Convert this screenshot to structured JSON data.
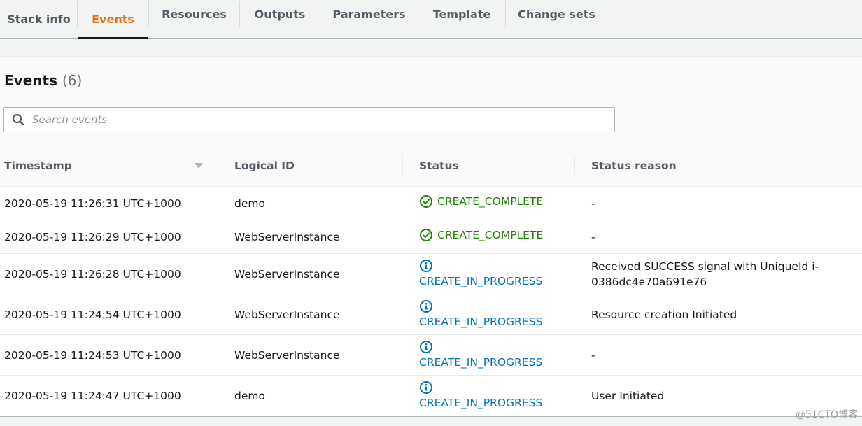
{
  "tabs": [
    {
      "label": "Stack info",
      "active": false
    },
    {
      "label": "Events",
      "active": true
    },
    {
      "label": "Resources",
      "active": false
    },
    {
      "label": "Outputs",
      "active": false
    },
    {
      "label": "Parameters",
      "active": false
    },
    {
      "label": "Template",
      "active": false
    },
    {
      "label": "Change sets",
      "active": false
    }
  ],
  "events": {
    "title": "Events",
    "count": "(6)",
    "search": {
      "placeholder": "Search events",
      "value": "",
      "icon": "search-icon"
    },
    "columns": [
      "Timestamp",
      "Logical ID",
      "Status",
      "Status reason"
    ],
    "sort_column": "Timestamp",
    "sort_direction": "descending",
    "rows": [
      {
        "timestamp": "2020-05-19 11:26:31 UTC+1000",
        "logical_id": "demo",
        "status": "CREATE_COMPLETE",
        "status_type": "complete",
        "reason": "-"
      },
      {
        "timestamp": "2020-05-19 11:26:29 UTC+1000",
        "logical_id": "WebServerInstance",
        "status": "CREATE_COMPLETE",
        "status_type": "complete",
        "reason": "-"
      },
      {
        "timestamp": "2020-05-19 11:26:28 UTC+1000",
        "logical_id": "WebServerInstance",
        "status": "CREATE_IN_PROGRESS",
        "status_type": "progress",
        "reason": "Received SUCCESS signal with UniqueId i-0386dc4e70a691e76"
      },
      {
        "timestamp": "2020-05-19 11:24:54 UTC+1000",
        "logical_id": "WebServerInstance",
        "status": "CREATE_IN_PROGRESS",
        "status_type": "progress",
        "reason": "Resource creation Initiated"
      },
      {
        "timestamp": "2020-05-19 11:24:53 UTC+1000",
        "logical_id": "WebServerInstance",
        "status": "CREATE_IN_PROGRESS",
        "status_type": "progress",
        "reason": "-"
      },
      {
        "timestamp": "2020-05-19 11:24:47 UTC+1000",
        "logical_id": "demo",
        "status": "CREATE_IN_PROGRESS",
        "status_type": "progress",
        "reason": "User Initiated"
      }
    ]
  },
  "colors": {
    "active_tab": "#ec7211",
    "complete": "#1d8102",
    "in_progress": "#0073bb"
  },
  "watermark": "@51CTO博客"
}
